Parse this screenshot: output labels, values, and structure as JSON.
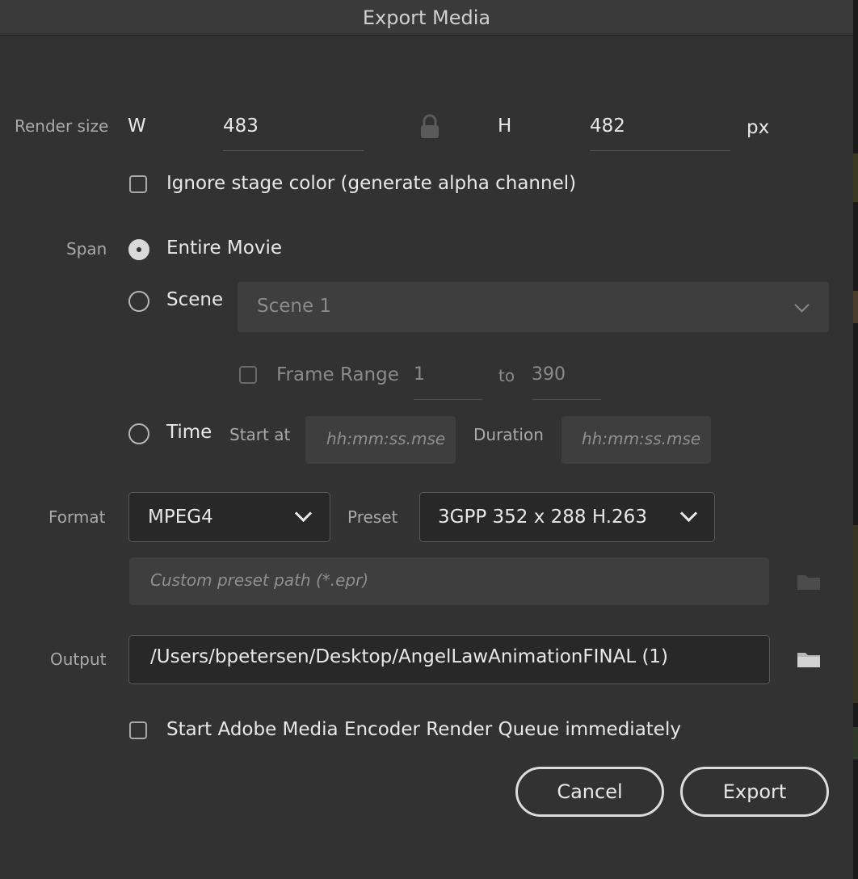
{
  "window": {
    "title": "Export Media"
  },
  "render_size": {
    "label": "Render size",
    "w_label": "W",
    "w_value": "483",
    "h_label": "H",
    "h_value": "482",
    "unit": "px",
    "ignore_stage_color_label": "Ignore stage color (generate alpha channel)"
  },
  "span": {
    "label": "Span",
    "entire_movie_label": "Entire Movie",
    "scene_label": "Scene",
    "scene_value": "Scene 1",
    "frame_range_label": "Frame Range",
    "frame_start": "1",
    "frame_to_label": "to",
    "frame_end": "390",
    "time_label": "Time",
    "start_at_label": "Start at",
    "start_at_placeholder": "hh:mm:ss.mse",
    "duration_label": "Duration",
    "duration_placeholder": "hh:mm:ss.mse"
  },
  "format": {
    "label": "Format",
    "value": "MPEG4",
    "preset_label": "Preset",
    "preset_value": "3GPP 352 x 288 H.263",
    "custom_preset_placeholder": "Custom preset path (*.epr)"
  },
  "output": {
    "label": "Output",
    "path": "/Users/bpetersen/Desktop/AngelLawAnimationFINAL (1)"
  },
  "queue": {
    "label": "Start Adobe Media Encoder Render Queue immediately"
  },
  "buttons": {
    "cancel": "Cancel",
    "export": "Export"
  },
  "icons": {
    "lock": "lock-icon",
    "folder": "folder-icon",
    "chevron": "chevron-down-icon"
  }
}
